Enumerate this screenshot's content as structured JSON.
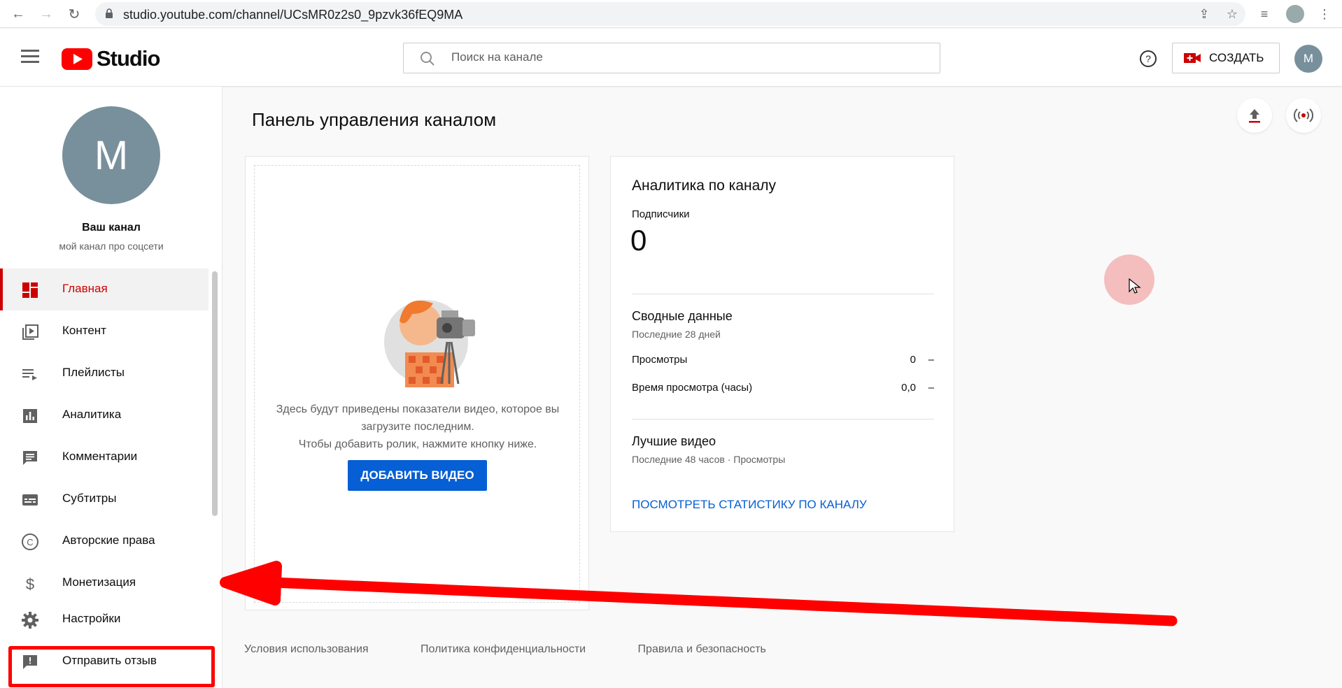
{
  "browser": {
    "url": "studio.youtube.com/channel/UCsMR0z2s0_9pzvk36fEQ9MA"
  },
  "header": {
    "logo_text": "Studio",
    "search_placeholder": "Поиск на канале",
    "create_label": "СОЗДАТЬ",
    "avatar_letter": "М"
  },
  "sidebar": {
    "avatar_letter": "М",
    "channel_name": "Ваш канал",
    "channel_desc": "мой канал про соцсети",
    "items": [
      {
        "label": "Главная",
        "icon": "dashboard-icon"
      },
      {
        "label": "Контент",
        "icon": "video-library-icon"
      },
      {
        "label": "Плейлисты",
        "icon": "playlist-icon"
      },
      {
        "label": "Аналитика",
        "icon": "analytics-icon"
      },
      {
        "label": "Комментарии",
        "icon": "comments-icon"
      },
      {
        "label": "Субтитры",
        "icon": "subtitles-icon"
      },
      {
        "label": "Авторские права",
        "icon": "copyright-icon"
      },
      {
        "label": "Монетизация",
        "icon": "dollar-icon"
      },
      {
        "label": "Настройки",
        "icon": "gear-icon"
      },
      {
        "label": "Отправить отзыв",
        "icon": "feedback-icon"
      }
    ]
  },
  "main": {
    "title": "Панель управления каналом",
    "video_card": {
      "line1": "Здесь будут приведены показатели видео, которое вы",
      "line2": "загрузите последним.",
      "line3": "Чтобы добавить ролик, нажмите кнопку ниже.",
      "button": "ДОБАВИТЬ ВИДЕО"
    },
    "analytics": {
      "title": "Аналитика по каналу",
      "subscribers_label": "Подписчики",
      "subscribers_value": "0",
      "summary_title": "Сводные данные",
      "summary_period": "Последние 28 дней",
      "rows": [
        {
          "label": "Просмотры",
          "value": "0",
          "delta": "–"
        },
        {
          "label": "Время просмотра (часы)",
          "value": "0,0",
          "delta": "–"
        }
      ],
      "top_title": "Лучшие видео",
      "top_period": "Последние 48 часов · Просмотры",
      "link": "ПОСМОТРЕТЬ СТАТИСТИКУ ПО КАНАЛУ"
    }
  },
  "footer": {
    "terms": "Условия использования",
    "privacy": "Политика конфиденциальности",
    "policy": "Правила и безопасность"
  },
  "colors": {
    "accent_red": "#cc0000",
    "link_blue": "#065fd4",
    "avatar_gray": "#78909c",
    "annotation_red": "#ff0000"
  }
}
